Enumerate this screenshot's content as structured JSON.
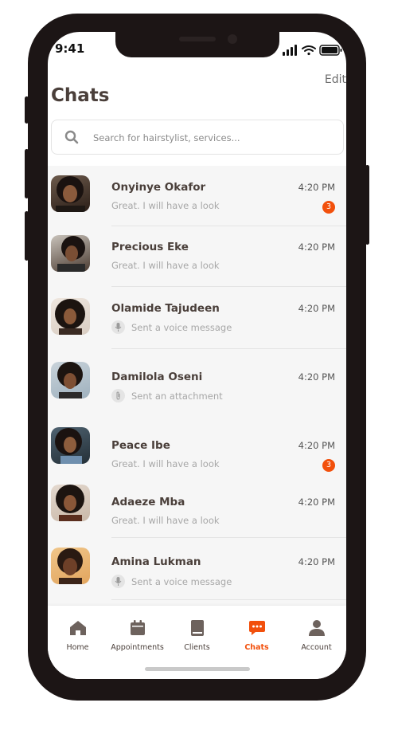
{
  "status_bar": {
    "time": "9:41"
  },
  "header": {
    "edit_label": "Edit",
    "title": "Chats"
  },
  "search": {
    "placeholder": "Search for hairstylist, services..."
  },
  "chats": [
    {
      "name": "Onyinye Okafor",
      "preview": "Great. I will have a look",
      "preview_icon": "",
      "time": "4:20 PM",
      "unread": "3"
    },
    {
      "name": "Precious Eke",
      "preview": "Great. I will have a look",
      "preview_icon": "",
      "time": "4:20 PM",
      "unread": ""
    },
    {
      "name": "Olamide Tajudeen",
      "preview": "Sent a voice message",
      "preview_icon": "microphone-icon",
      "time": "4:20 PM",
      "unread": ""
    },
    {
      "name": "Damilola Oseni",
      "preview": "Sent an attachment",
      "preview_icon": "attachment-icon",
      "time": "4:20 PM",
      "unread": ""
    },
    {
      "name": "Peace Ibe",
      "preview": "Great. I will have a look",
      "preview_icon": "",
      "time": "4:20 PM",
      "unread": "3"
    },
    {
      "name": "Adaeze Mba",
      "preview": "Great. I will have a look",
      "preview_icon": "",
      "time": "4:20 PM",
      "unread": ""
    },
    {
      "name": "Amina Lukman",
      "preview": "Sent a voice message",
      "preview_icon": "microphone-icon",
      "time": "4:20 PM",
      "unread": ""
    }
  ],
  "tabs": [
    {
      "label": "Home",
      "icon": "home-icon"
    },
    {
      "label": "Appointments",
      "icon": "calendar-icon"
    },
    {
      "label": "Clients",
      "icon": "book-icon"
    },
    {
      "label": "Chats",
      "icon": "chat-bubble-icon",
      "active": true
    },
    {
      "label": "Account",
      "icon": "user-icon"
    }
  ],
  "colors": {
    "accent": "#f2500c",
    "text_dark": "#4a3f3a",
    "muted": "#a7a7a7",
    "list_bg": "#f6f6f6"
  }
}
